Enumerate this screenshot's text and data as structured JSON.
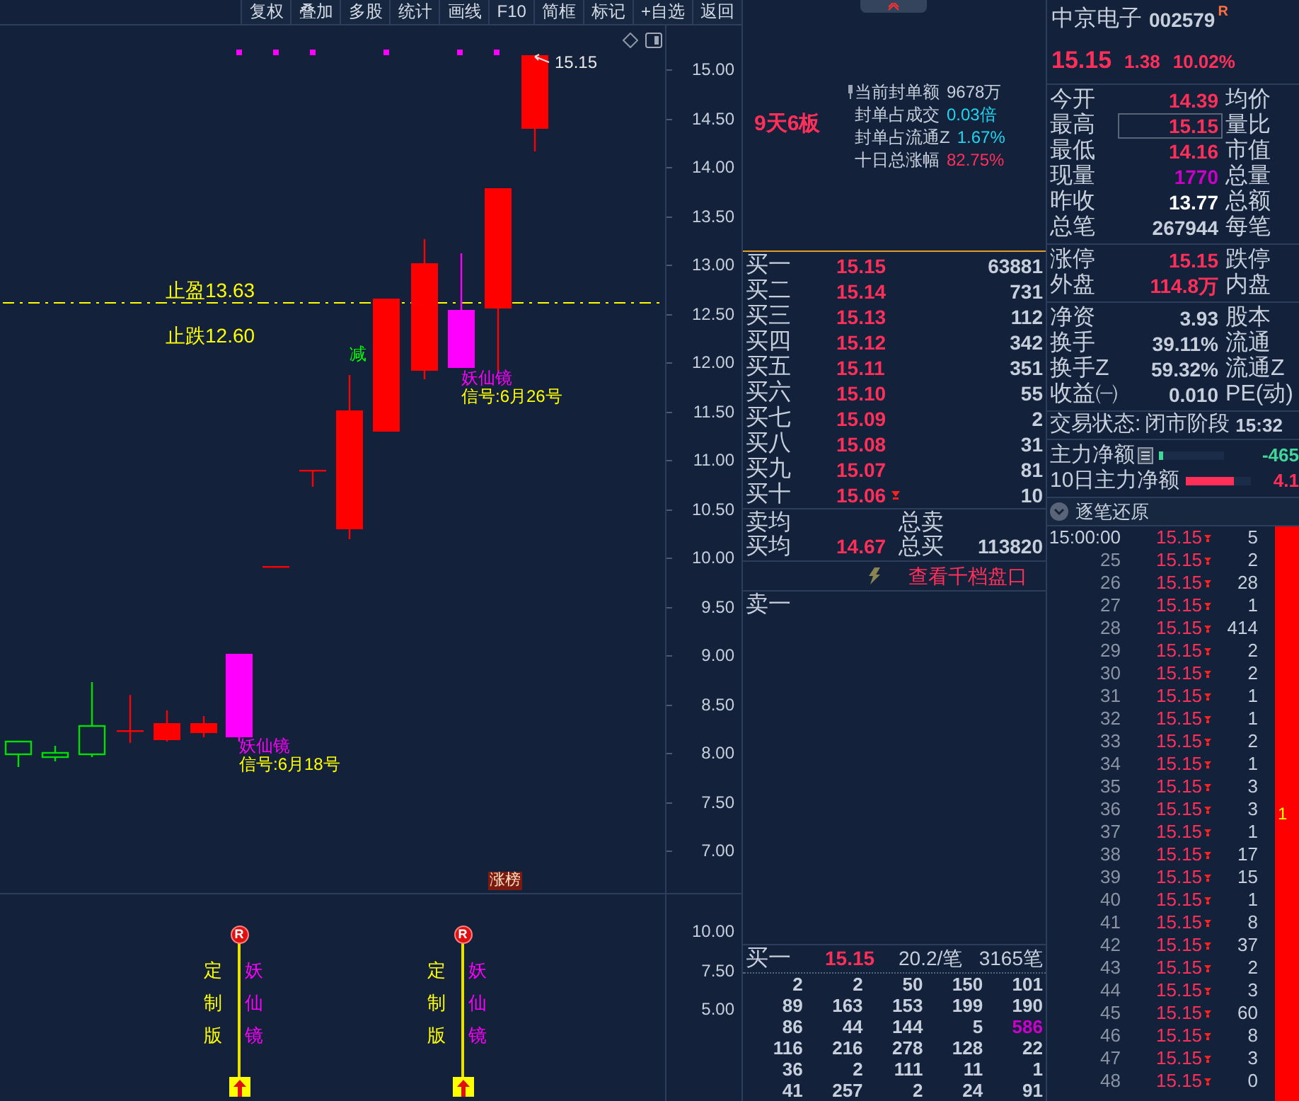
{
  "chart": {
    "toolbar": [
      "复权",
      "叠加",
      "多股",
      "统计",
      "画线",
      "F10",
      "简框",
      "标记",
      "+自选",
      "返回"
    ],
    "price_axis": [
      "15.00",
      "14.50",
      "14.00",
      "13.50",
      "13.00",
      "12.50",
      "12.00",
      "11.50",
      "11.00",
      "10.50",
      "10.00",
      "9.50",
      "9.00",
      "8.50",
      "8.00",
      "7.50",
      "7.00"
    ],
    "last_price": "15.15",
    "stop_labels": [
      {
        "label": "止盈",
        "value": "13.63"
      },
      {
        "label": "止跌",
        "value": "12.60"
      }
    ],
    "reduce_mark": "减",
    "signals": [
      {
        "name": "妖仙镜",
        "date": "信号:6月18号"
      },
      {
        "name": "妖仙镜",
        "date": "信号:6月26号"
      }
    ],
    "badge": "涨榜",
    "indicator": {
      "axis": [
        "10.00",
        "7.50",
        "5.00"
      ],
      "markers": [
        {
          "badge": "R",
          "left": "定制版",
          "right": "妖仙镜"
        },
        {
          "badge": "R",
          "left": "定制版",
          "right": "妖仙镜"
        }
      ]
    }
  },
  "limit_info": {
    "streak": "9天6板",
    "rows": [
      {
        "label": "当前封单额",
        "value": "9678万",
        "color": "#c7cfdc"
      },
      {
        "label": "封单占成交",
        "value": "0.03倍",
        "color": "#1ed6f0"
      },
      {
        "label": "封单占流通Z",
        "value": "1.67%",
        "color": "#1ed6f0"
      },
      {
        "label": "十日总涨幅",
        "value": "82.75%",
        "color": "#ff2f5a"
      }
    ]
  },
  "order_book": {
    "bids": [
      {
        "label": "买一",
        "price": "15.15",
        "volume": "63881",
        "flag": false
      },
      {
        "label": "买二",
        "price": "15.14",
        "volume": "731",
        "flag": false
      },
      {
        "label": "买三",
        "price": "15.13",
        "volume": "112",
        "flag": false
      },
      {
        "label": "买四",
        "price": "15.12",
        "volume": "342",
        "flag": false
      },
      {
        "label": "买五",
        "price": "15.11",
        "volume": "351",
        "flag": false
      },
      {
        "label": "买六",
        "price": "15.10",
        "volume": "55",
        "flag": false
      },
      {
        "label": "买七",
        "price": "15.09",
        "volume": "2",
        "flag": false
      },
      {
        "label": "买八",
        "price": "15.08",
        "volume": "31",
        "flag": false
      },
      {
        "label": "买九",
        "price": "15.07",
        "volume": "81",
        "flag": false
      },
      {
        "label": "买十",
        "price": "15.06",
        "volume": "10",
        "flag": true
      }
    ],
    "avg_sell": {
      "label": "卖均"
    },
    "total_sell": {
      "label": "总卖"
    },
    "avg_buy": {
      "label": "买均",
      "value": "14.67"
    },
    "total_buy": {
      "label": "总买",
      "value": "113820"
    },
    "link": "查看千档盘口",
    "asks": [
      {
        "label": "卖一"
      }
    ]
  },
  "queue": {
    "label": "买一",
    "price": "15.15",
    "avg": "20.2/笔",
    "count": "3165笔",
    "rows": [
      [
        {
          "text": "2",
          "large": false
        },
        {
          "text": "2",
          "large": false
        },
        {
          "text": "50",
          "large": false
        },
        {
          "text": "150",
          "large": false
        },
        {
          "text": "101",
          "large": false
        }
      ],
      [
        {
          "text": "89",
          "large": false
        },
        {
          "text": "163",
          "large": false
        },
        {
          "text": "153",
          "large": false
        },
        {
          "text": "199",
          "large": false
        },
        {
          "text": "190",
          "large": false
        }
      ],
      [
        {
          "text": "86",
          "large": false
        },
        {
          "text": "44",
          "large": false
        },
        {
          "text": "144",
          "large": false
        },
        {
          "text": "5",
          "large": false
        },
        {
          "text": "586",
          "large": true
        }
      ],
      [
        {
          "text": "116",
          "large": false
        },
        {
          "text": "216",
          "large": false
        },
        {
          "text": "278",
          "large": false
        },
        {
          "text": "128",
          "large": false
        },
        {
          "text": "22",
          "large": false
        }
      ],
      [
        {
          "text": "36",
          "large": false
        },
        {
          "text": "2",
          "large": false
        },
        {
          "text": "111",
          "large": false
        },
        {
          "text": "11",
          "large": false
        },
        {
          "text": "1",
          "large": false
        }
      ],
      [
        {
          "text": "41",
          "large": false
        },
        {
          "text": "257",
          "large": false
        },
        {
          "text": "2",
          "large": false
        },
        {
          "text": "24",
          "large": false
        },
        {
          "text": "91",
          "large": false
        }
      ]
    ]
  },
  "stock": {
    "name": "中京电子",
    "code": "002579",
    "badge": "R",
    "price": "15.15",
    "change": "1.38",
    "pct": "10.02%"
  },
  "quote_sections": [
    [
      {
        "label": "今开",
        "value": "14.39",
        "color": "#ff2f5a",
        "boxed": false,
        "label2": "均价"
      },
      {
        "label": "最高",
        "value": "15.15",
        "color": "#ff2f5a",
        "boxed": true,
        "label2": "量比"
      },
      {
        "label": "最低",
        "value": "14.16",
        "color": "#ff2f5a",
        "boxed": false,
        "label2": "市值"
      },
      {
        "label": "现量",
        "value": "1770",
        "color": "#c800c8",
        "boxed": false,
        "label2": "总量"
      },
      {
        "label": "昨收",
        "value": "13.77",
        "color": "#ffffff",
        "boxed": false,
        "label2": "总额"
      },
      {
        "label": "总笔",
        "value": "267944",
        "color": "#c7cfdc",
        "boxed": false,
        "label2": "每笔"
      }
    ],
    [
      {
        "label": "涨停",
        "value": "15.15",
        "color": "#ff2f5a",
        "boxed": false,
        "label2": "跌停"
      },
      {
        "label": "外盘",
        "value": "114.8万",
        "color": "#ff2f5a",
        "boxed": false,
        "label2": "内盘"
      }
    ],
    [
      {
        "label": "净资",
        "value": "3.93",
        "color": "#c7cfdc",
        "boxed": false,
        "label2": "股本"
      },
      {
        "label": "换手",
        "value": "39.11%",
        "color": "#c7cfdc",
        "boxed": false,
        "label2": "流通"
      },
      {
        "label": "换手Z",
        "value": "59.32%",
        "color": "#c7cfdc",
        "boxed": false,
        "label2": "流通Z"
      },
      {
        "label": "收益㈠",
        "value": "0.010",
        "color": "#c7cfdc",
        "boxed": false,
        "label2": "PE(动)"
      }
    ]
  ],
  "trade_status": {
    "label": "交易状态:",
    "value": "闭市阶段",
    "time": "15:32"
  },
  "main_flow": [
    {
      "label": "主力净额",
      "value": "-465",
      "level": 0.06,
      "color": "#3fd89a"
    },
    {
      "label": "10日主力净额",
      "value": "4.1",
      "level": 0.75,
      "color": "#ff2f5a"
    }
  ],
  "ticks": {
    "title": "逐笔还原",
    "bar_label": "1",
    "rows": [
      {
        "time": "15:00:00",
        "price": "15.15",
        "volume": "5"
      },
      {
        "time": "25",
        "price": "15.15",
        "volume": "2"
      },
      {
        "time": "26",
        "price": "15.15",
        "volume": "28"
      },
      {
        "time": "27",
        "price": "15.15",
        "volume": "1"
      },
      {
        "time": "28",
        "price": "15.15",
        "volume": "414"
      },
      {
        "time": "29",
        "price": "15.15",
        "volume": "2"
      },
      {
        "time": "30",
        "price": "15.15",
        "volume": "2"
      },
      {
        "time": "31",
        "price": "15.15",
        "volume": "1"
      },
      {
        "time": "32",
        "price": "15.15",
        "volume": "1"
      },
      {
        "time": "33",
        "price": "15.15",
        "volume": "2"
      },
      {
        "time": "34",
        "price": "15.15",
        "volume": "1"
      },
      {
        "time": "35",
        "price": "15.15",
        "volume": "3"
      },
      {
        "time": "36",
        "price": "15.15",
        "volume": "3"
      },
      {
        "time": "37",
        "price": "15.15",
        "volume": "1"
      },
      {
        "time": "38",
        "price": "15.15",
        "volume": "17"
      },
      {
        "time": "39",
        "price": "15.15",
        "volume": "15"
      },
      {
        "time": "40",
        "price": "15.15",
        "volume": "1"
      },
      {
        "time": "41",
        "price": "15.15",
        "volume": "8"
      },
      {
        "time": "42",
        "price": "15.15",
        "volume": "37"
      },
      {
        "time": "43",
        "price": "15.15",
        "volume": "2"
      },
      {
        "time": "44",
        "price": "15.15",
        "volume": "3"
      },
      {
        "time": "45",
        "price": "15.15",
        "volume": "60"
      },
      {
        "time": "46",
        "price": "15.15",
        "volume": "8"
      },
      {
        "time": "47",
        "price": "15.15",
        "volume": "3"
      },
      {
        "time": "48",
        "price": "15.15",
        "volume": "0"
      }
    ]
  }
}
